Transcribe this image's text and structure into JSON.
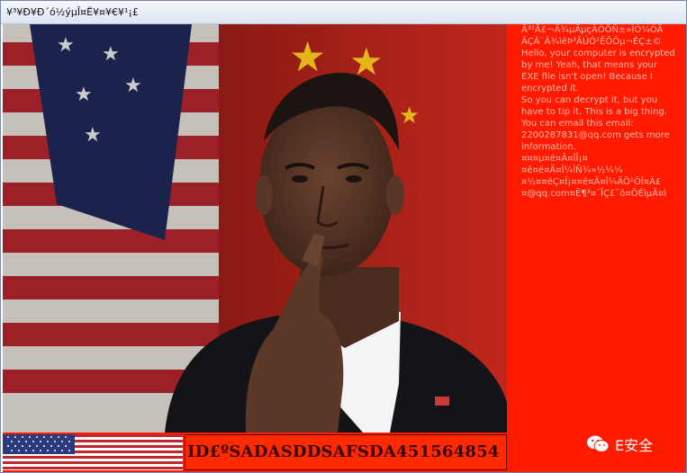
{
  "window": {
    "title": "¥³¥Ð¥Ð´ó½ýµÎ¤Ë¥¤¥€¥¹¡£"
  },
  "panel": {
    "garbled_line_1": "Ã³²Ã£¬Ä¾µÄµçÄÔÖÑ±»ÎÒ¼ÓÃ",
    "garbled_line_2": "ÃÇÂ¨Ä¾ìëÞ³ÃÚÔ¹ËÕÔµ¬ÉÇ±©",
    "message": "Hello, your computer is encrypted by me! Yeah, that means your EXE file isn't open! Because I encrypted it.\nSo you can decrypt it, but you have to tip it. This is a big thing. You can email this email:",
    "contact": "2200287831@qq.com gets more information.",
    "garbled_line_3": "¤¤¤µ¤ë¤Ä¤ÎÎ¡¤¤ê¤ë¤Ä¤Î¼ÌÑ¾»½¼¼",
    "garbled_line_4": "¤½¤¤ëÇ¤Ï¡¤¤ê¤Ä¤Î¼ÃÕ¹ÖÎ¤Ä£¤@qq.com¤Ë¶³¤¯ÎÇ£¯ö¤ÕÉìµÃ¤ì"
  },
  "victim_id": "ID£ºSADASDDSAFSDA451564854",
  "watermark": {
    "text": "E安全",
    "icon": "wechat-icon"
  },
  "colors": {
    "panel_red": "#ff1a00",
    "panel_text": "#ffb8a8",
    "id_text": "#3a0000"
  }
}
